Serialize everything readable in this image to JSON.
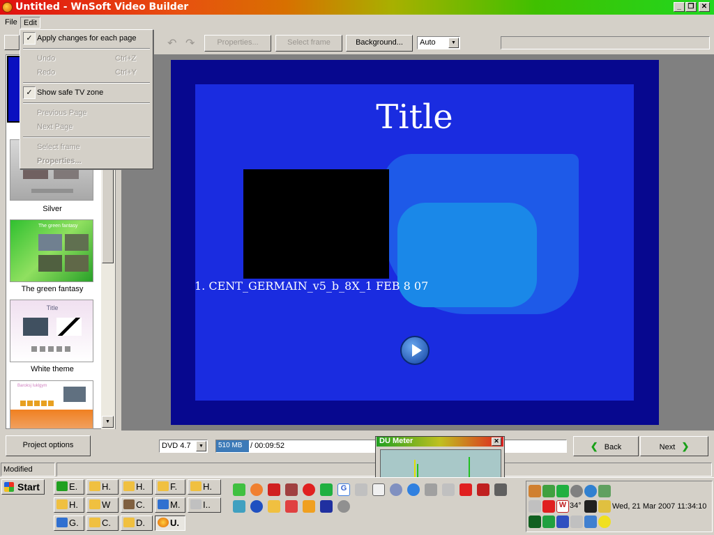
{
  "window": {
    "title": "Untitled - WnSoft Video Builder"
  },
  "menu": {
    "file": "File",
    "edit": "Edit"
  },
  "edit_menu": {
    "apply_changes": "Apply changes for each page",
    "undo": "Undo",
    "undo_shortcut": "Ctrl+Z",
    "redo": "Redo",
    "redo_shortcut": "Ctrl+Y",
    "show_safe_tv": "Show safe TV zone",
    "previous_page": "Previous Page",
    "next_page": "Next Page",
    "select_frame": "Select frame",
    "properties": "Properties..."
  },
  "toolbar": {
    "properties": "Properties...",
    "select_frame": "Select frame",
    "background": "Background...",
    "auto_value": "Auto"
  },
  "themes": [
    {
      "label": "Silver"
    },
    {
      "label": "The green fantasy",
      "thumb_caption": "The green fantasy"
    },
    {
      "label": "White theme",
      "thumb_caption": "Title"
    },
    {
      "label": "",
      "thumb_caption": "Baroksj Iuklgym"
    }
  ],
  "preview": {
    "title": "Title",
    "chapter": "1. CENT_GERMAIN_v5_b_8X_1 FEB 8 07"
  },
  "bottom": {
    "project_options": "Project options",
    "disc_type": "DVD 4.7",
    "size": "510 MB",
    "duration": "/ 00:09:52",
    "back": "Back",
    "next": "Next"
  },
  "status": {
    "text": "Modified"
  },
  "du_meter": {
    "title": "DU Meter"
  },
  "taskbar": {
    "start": "Start",
    "row1": [
      "E.",
      "H.",
      "H.",
      "F.",
      "H."
    ],
    "row2": [
      "H.",
      "W",
      "C.",
      "M.",
      "I.."
    ],
    "row3": [
      "G.",
      "C.",
      "D.",
      "U."
    ],
    "temperature": "34°",
    "clock": "Wed, 21 Mar 2007   11:34:10"
  },
  "colors": {
    "preview_bg": "#07088f",
    "safe_zone": "#1a2ce0",
    "titlebar_start": "#e01010",
    "titlebar_end": "#20d820"
  }
}
